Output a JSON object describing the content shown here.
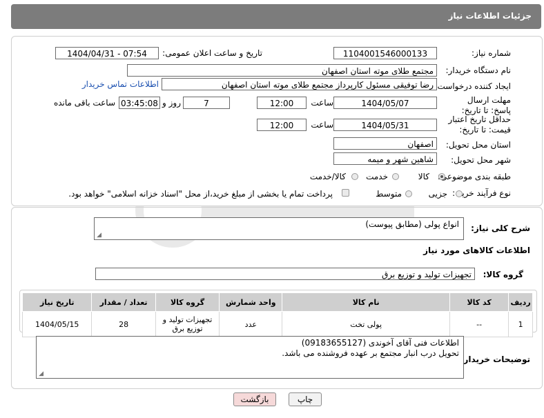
{
  "header": {
    "title": "جزئیات اطلاعات نیاز"
  },
  "fields": {
    "need_number_label": "شماره نیاز:",
    "need_number": "1104001546000133",
    "announce_label": "تاریخ و ساعت اعلان عمومی:",
    "announce_value": "1404/04/31 - 07:54",
    "buyer_org_label": "نام دستگاه خریدار:",
    "buyer_org": "مجتمع طلای موته استان اصفهان",
    "creator_label": "ایجاد کننده درخواست:",
    "creator": "رضا توفیقی مسئول کارپرداز مجتمع طلای موته استان اصفهان",
    "buyer_contact_link": "اطلاعات تماس خریدار",
    "deadline_label": "مهلت ارسال پاسخ: تا تاریخ:",
    "deadline_date": "1404/05/07",
    "time_label": "ساعت",
    "deadline_time": "12:00",
    "days_value": "7",
    "days_label": "روز و",
    "remaining_time": "03:45:08",
    "remaining_label": "ساعت باقی مانده",
    "price_valid_label": "حداقل تاریخ اعتبار قیمت: تا تاریخ:",
    "price_valid_date": "1404/05/31",
    "price_valid_time": "12:00",
    "province_label": "استان محل تحویل:",
    "province": "اصفهان",
    "city_label": "شهر محل تحویل:",
    "city": "شاهین شهر و میمه",
    "category_label": "طبقه بندی موضوعی:",
    "category_options": [
      "کالا",
      "خدمت",
      "کالا/خدمت"
    ],
    "process_label": "نوع فرآیند خرید :",
    "process_options": [
      "جزیی",
      "متوسط"
    ],
    "payment_note": "پرداخت تمام یا بخشی از مبلغ خرید،از محل \"اسناد خزانه اسلامی\" خواهد بود."
  },
  "description": {
    "label": "شرح کلی نیاز:",
    "value": "انواع پولی (مطابق پیوست)"
  },
  "goods_section": {
    "title": "اطلاعات کالاهای مورد نیاز",
    "group_label": "گروه کالا:",
    "group_value": "تجهیزات تولید و توزیع برق"
  },
  "table": {
    "headers": [
      "ردیف",
      "کد کالا",
      "نام کالا",
      "واحد شمارش",
      "گروه کالا",
      "تعداد / مقدار",
      "تاریخ نیاز"
    ],
    "rows": [
      [
        "1",
        "--",
        "پولی تخت",
        "عدد",
        "تجهیزات تولید و توزیع برق",
        "28",
        "1404/05/15"
      ]
    ]
  },
  "buyer_notes": {
    "label": "توضیحات خریدار:",
    "line1": "اطلاعات فنی آقای آخوندی (09183655127)",
    "line2": "تحویل درب انبار مجتمع بر عهده فروشنده می باشد."
  },
  "buttons": {
    "print": "چاپ",
    "back": "بازگشت"
  },
  "colors": {
    "header_bg": "#7c7c7c",
    "link": "#1a4fb0",
    "back_button_bg": "#f6d9d9",
    "print_button_bg": "#f2f2f2"
  }
}
